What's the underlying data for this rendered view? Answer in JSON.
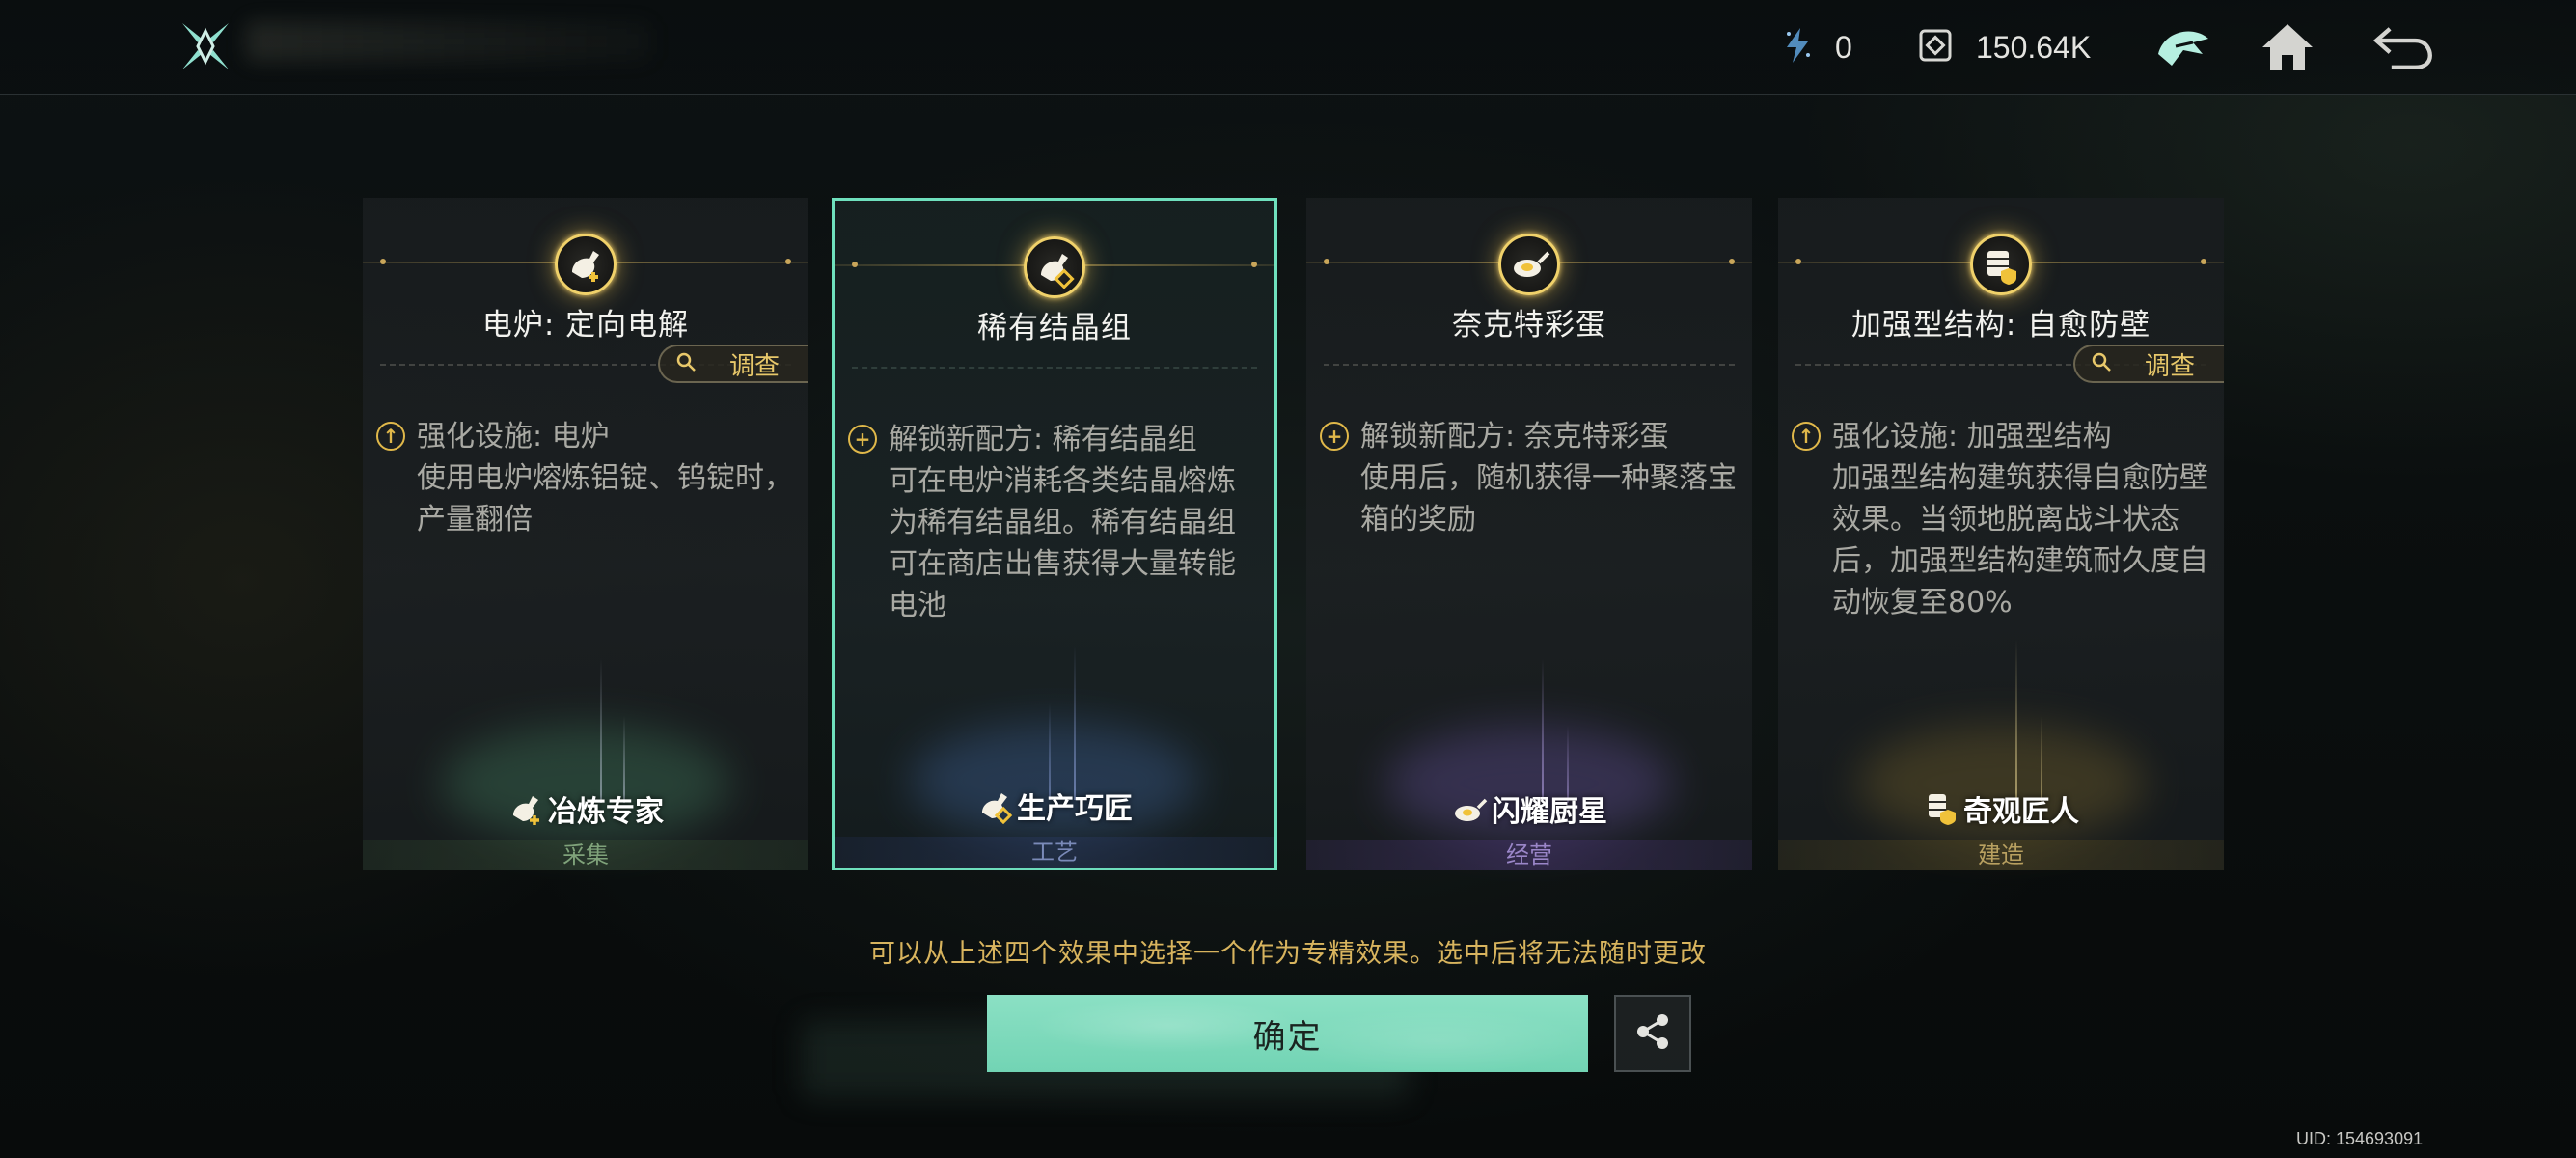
{
  "header": {
    "energy_value": "0",
    "credits_value": "150.64K",
    "icons": [
      "game-logo-icon",
      "energy-icon",
      "credits-icon",
      "helmet-icon",
      "home-icon",
      "back-arrow-icon"
    ]
  },
  "cards": [
    {
      "title": "电炉: 定向电解",
      "investigate_label": "调查",
      "bullet_icon": "upgrade-icon",
      "desc_heading": "强化设施: 电炉",
      "desc_body": "使用电炉熔炼铝锭、钨锭时，产量翻倍",
      "badge_label": "冶炼专家",
      "category": "采集",
      "category_color": "#7fa27a",
      "glow_color": "#3c6f55"
    },
    {
      "title": "稀有结晶组",
      "bullet_icon": "unlock-recipe-icon",
      "desc_heading": "解锁新配方: 稀有结晶组",
      "desc_body": "可在电炉消耗各类结晶熔炼为稀有结晶组。稀有结晶组可在商店出售获得大量转能电池",
      "badge_label": "生产巧匠",
      "category": "工艺",
      "category_color": "#7a8ab8",
      "glow_color": "#3a5a8a",
      "selected": true
    },
    {
      "title": "奈克特彩蛋",
      "bullet_icon": "unlock-recipe-icon",
      "desc_heading": "解锁新配方: 奈克特彩蛋",
      "desc_body": "使用后，随机获得一种聚落宝箱的奖励",
      "badge_label": "闪耀厨星",
      "category": "经营",
      "category_color": "#9a86c8",
      "glow_color": "#5a4a8a"
    },
    {
      "title": "加强型结构: 自愈防壁",
      "investigate_label": "调查",
      "bullet_icon": "upgrade-icon",
      "desc_heading": "强化设施: 加强型结构",
      "desc_body": "加强型结构建筑获得自愈防壁效果。当领地脱离战斗状态后，加强型结构建筑耐久度自动恢复至80%",
      "badge_label": "奇观匠人",
      "category": "建造",
      "category_color": "#b8a060",
      "glow_color": "#6a5a2a"
    }
  ],
  "footer": {
    "hint": "可以从上述四个效果中选择一个作为专精效果。选中后将无法随时更改",
    "confirm_label": "确定",
    "uid": "UID: 154693091"
  }
}
